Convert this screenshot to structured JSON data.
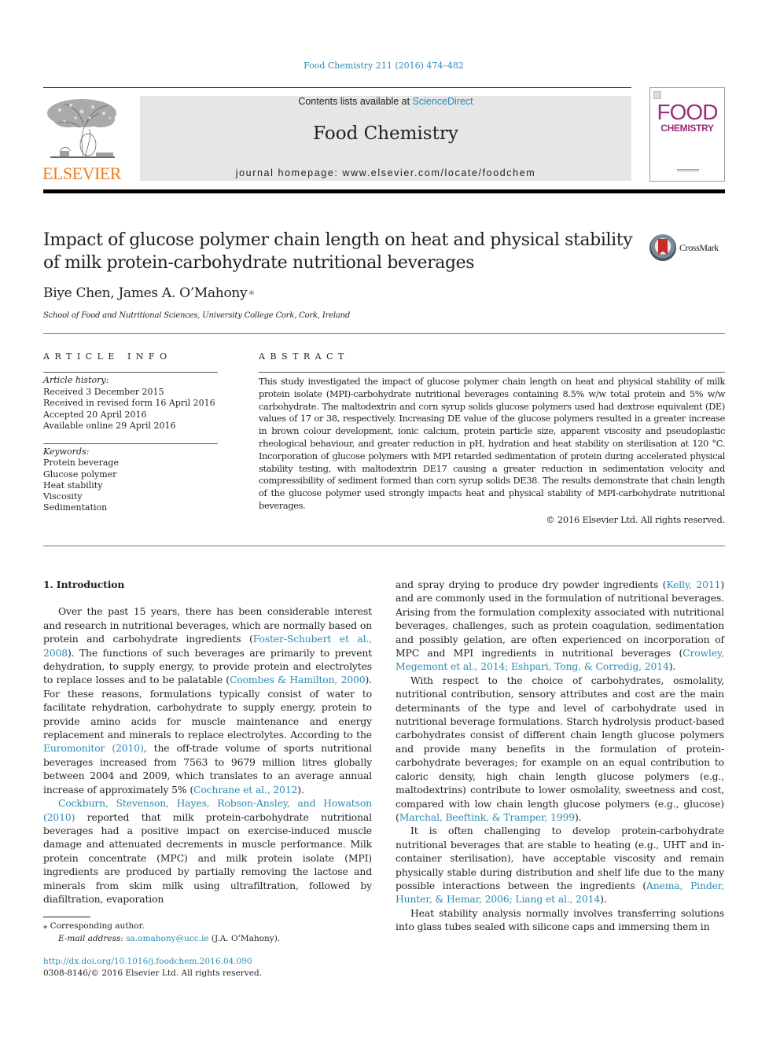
{
  "header": {
    "citation": "Food Chemistry 211 (2016) 474–482",
    "publisher_logo_text": "ELSEVIER",
    "contents_prefix": "Contents lists available at ",
    "contents_link": "ScienceDirect",
    "journal_name": "Food Chemistry",
    "homepage": "journal homepage: www.elsevier.com/locate/foodchem",
    "cover": {
      "line1": "FOOD",
      "line2": "CHEMISTRY"
    },
    "colors": {
      "link": "#2a8bb5",
      "elsevier_orange": "#f07d1a",
      "cover_magenta": "#9b2c7e",
      "masthead_bg": "#e6e6e6"
    }
  },
  "article": {
    "title": "Impact of glucose polymer chain length on heat and physical stability of milk protein-carbohydrate nutritional beverages",
    "crossmark_label": "CrossMark",
    "authors": "Biye Chen, James A. O’Mahony",
    "author_marker": "⁎",
    "affiliation": "School of Food and Nutritional Sciences, University College Cork, Cork, Ireland"
  },
  "article_info": {
    "heading": "ARTICLE INFO",
    "history_label": "Article history:",
    "history": [
      "Received 3 December 2015",
      "Received in revised form 16 April 2016",
      "Accepted 20 April 2016",
      "Available online 29 April 2016"
    ],
    "keywords_label": "Keywords:",
    "keywords": [
      "Protein beverage",
      "Glucose polymer",
      "Heat stability",
      "Viscosity",
      "Sedimentation"
    ]
  },
  "abstract": {
    "heading": "ABSTRACT",
    "text": "This study investigated the impact of glucose polymer chain length on heat and physical stability of milk protein isolate (MPI)-carbohydrate nutritional beverages containing 8.5% w/w total protein and 5% w/w carbohydrate. The maltodextrin and corn syrup solids glucose polymers used had dextrose equivalent (DE) values of 17 or 38, respectively. Increasing DE value of the glucose polymers resulted in a greater increase in brown colour development, ionic calcium, protein particle size, apparent viscosity and pseudoplastic rheological behaviour, and greater reduction in pH, hydration and heat stability on sterilisation at 120 °C. Incorporation of glucose polymers with MPI retarded sedimentation of protein during accelerated physical stability testing, with maltodextrin DE17 causing a greater reduction in sedimentation velocity and compressibility of sediment formed than corn syrup solids DE38. The results demonstrate that chain length of the glucose polymer used strongly impacts heat and physical stability of MPI-carbohydrate nutritional beverages.",
    "copyright": "© 2016 Elsevier Ltd. All rights reserved."
  },
  "body": {
    "section_heading": "1. Introduction",
    "left": {
      "p1": [
        {
          "t": "Over the past 15 years, there has been considerable interest and research in nutritional beverages, which are normally based on protein and carbohydrate ingredients ("
        },
        {
          "t": "Foster-Schubert et al., 2008",
          "link": true
        },
        {
          "t": "). The functions of such beverages are primarily to prevent dehydration, to supply energy, to provide protein and electrolytes to replace losses and to be palatable ("
        },
        {
          "t": "Coombes & Hamilton, 2000",
          "link": true
        },
        {
          "t": "). For these reasons, formulations typically consist of water to facilitate rehydration, carbohydrate to supply energy, protein to provide amino acids for muscle maintenance and energy replacement and minerals to replace electrolytes. According to the "
        },
        {
          "t": "Euromonitor (2010)",
          "link": true
        },
        {
          "t": ", the off-trade volume of sports nutritional beverages increased from 7563 to 9679 million litres globally between 2004 and 2009, which translates to an average annual increase of approximately 5% ("
        },
        {
          "t": "Cochrane et al., 2012",
          "link": true
        },
        {
          "t": ")."
        }
      ],
      "p2": [
        {
          "t": "Cockburn, Stevenson, Hayes, Robson-Ansley, and Howatson (2010)",
          "link": true
        },
        {
          "t": " reported that milk protein-carbohydrate nutritional beverages had a positive impact on exercise-induced muscle damage and attenuated decrements in muscle performance. Milk protein concentrate (MPC) and milk protein isolate (MPI) ingredients are produced by partially removing the lactose and minerals from skim milk using ultrafiltration, followed by diafiltration, evaporation"
        }
      ]
    },
    "right": {
      "p1": [
        {
          "t": "and spray drying to produce dry powder ingredients ("
        },
        {
          "t": "Kelly, 2011",
          "link": true
        },
        {
          "t": ") and are commonly used in the formulation of nutritional beverages. Arising from the formulation complexity associated with nutritional beverages, challenges, such as protein coagulation, sedimentation and possibly gelation, are often experienced on incorporation of MPC and MPI ingredients in nutritional beverages ("
        },
        {
          "t": "Crowley, Megemont et al., 2014; Eshpari, Tong, & Corredig, 2014",
          "link": true
        },
        {
          "t": ")."
        }
      ],
      "p2": [
        {
          "t": "With respect to the choice of carbohydrates, osmolality, nutritional contribution, sensory attributes and cost are the main determinants of the type and level of carbohydrate used in nutritional beverage formulations. Starch hydrolysis product-based carbohydrates consist of different chain length glucose polymers and provide many benefits in the formulation of protein-carbohydrate beverages; for example on an equal contribution to caloric density, high chain length glucose polymers (e.g., maltodextrins) contribute to lower osmolality, sweetness and cost, compared with low chain length glucose polymers (e.g., glucose) ("
        },
        {
          "t": "Marchal, Beeftink, & Tramper, 1999",
          "link": true
        },
        {
          "t": ")."
        }
      ],
      "p3": [
        {
          "t": "It is often challenging to develop protein-carbohydrate nutritional beverages that are stable to heating (e.g., UHT and in-container sterilisation), have acceptable viscosity and remain physically stable during distribution and shelf life due to the many possible interactions between the ingredients ("
        },
        {
          "t": "Anema, Pinder, Hunter, & Hemar, 2006; Liang et al., 2014",
          "link": true
        },
        {
          "t": ")."
        }
      ],
      "p4": [
        {
          "t": "Heat stability analysis normally involves transferring solutions into glass tubes sealed with silicone caps and immersing them in"
        }
      ]
    }
  },
  "footnote": {
    "marker": "⁎",
    "corresponding": "Corresponding author.",
    "email_label": "E-mail address: ",
    "email": "sa.omahony@ucc.ie",
    "email_suffix": " (J.A. O’Mahony).",
    "doi": "http://dx.doi.org/10.1016/j.foodchem.2016.04.090",
    "issn_line": "0308-8146/© 2016 Elsevier Ltd. All rights reserved."
  }
}
